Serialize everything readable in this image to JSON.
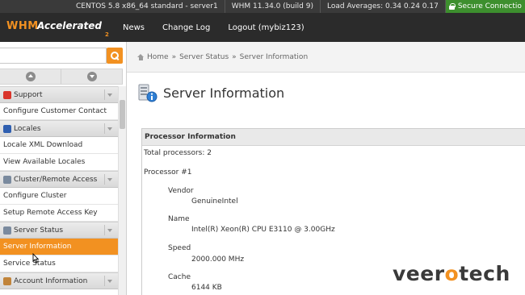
{
  "topbar": {
    "os": "CENTOS 5.8 x86_64 standard - server1",
    "whm_version": "WHM 11.34.0 (build 9)",
    "load_averages": "Load Averages: 0.34 0.24 0.17",
    "secure": "Secure Connectio"
  },
  "nav": {
    "logo_whm": "WHM",
    "logo_accelerated": "Accelerated",
    "logo_two": "2",
    "news": "News",
    "changelog": "Change Log",
    "logout": "Logout (mybiz123)"
  },
  "breadcrumb": {
    "home": "Home",
    "sep": "»",
    "section": "Server Status",
    "page": "Server Information"
  },
  "sidebar": {
    "search_placeholder": "",
    "menu": [
      {
        "type": "cat",
        "label": "Support",
        "icon": "support-icon"
      },
      {
        "type": "item",
        "label": "Configure Customer Contact"
      },
      {
        "type": "cat",
        "label": "Locales",
        "icon": "flag-icon"
      },
      {
        "type": "item",
        "label": "Locale XML Download"
      },
      {
        "type": "item",
        "label": "View Available Locales"
      },
      {
        "type": "cat",
        "label": "Cluster/Remote Access",
        "icon": "cluster-icon"
      },
      {
        "type": "item",
        "label": "Configure Cluster"
      },
      {
        "type": "item",
        "label": "Setup Remote Access Key"
      },
      {
        "type": "cat",
        "label": "Server Status",
        "icon": "server-status-icon"
      },
      {
        "type": "item",
        "label": "Server Information",
        "active": true
      },
      {
        "type": "item",
        "label": "Service Status"
      },
      {
        "type": "cat",
        "label": "Account Information",
        "icon": "account-icon"
      }
    ]
  },
  "main": {
    "title": "Server Information",
    "panel_title": "Processor Information",
    "total_processors": "Total processors: 2",
    "processor_label": "Processor #1",
    "vendor_label": "Vendor",
    "vendor_value": "GenuineIntel",
    "name_label": "Name",
    "name_value": "Intel(R) Xeon(R) CPU E3110 @ 3.00GHz",
    "speed_label": "Speed",
    "speed_value": "2000.000 MHz",
    "cache_label": "Cache",
    "cache_value": "6144 KB"
  },
  "watermark": {
    "part1": "veer",
    "part2": "o",
    "part3": "tech"
  },
  "colors": {
    "accent": "#f29121",
    "topbar": "#3a3a3a",
    "navbar": "#2b2b2b",
    "secure": "#3d8f2e"
  }
}
